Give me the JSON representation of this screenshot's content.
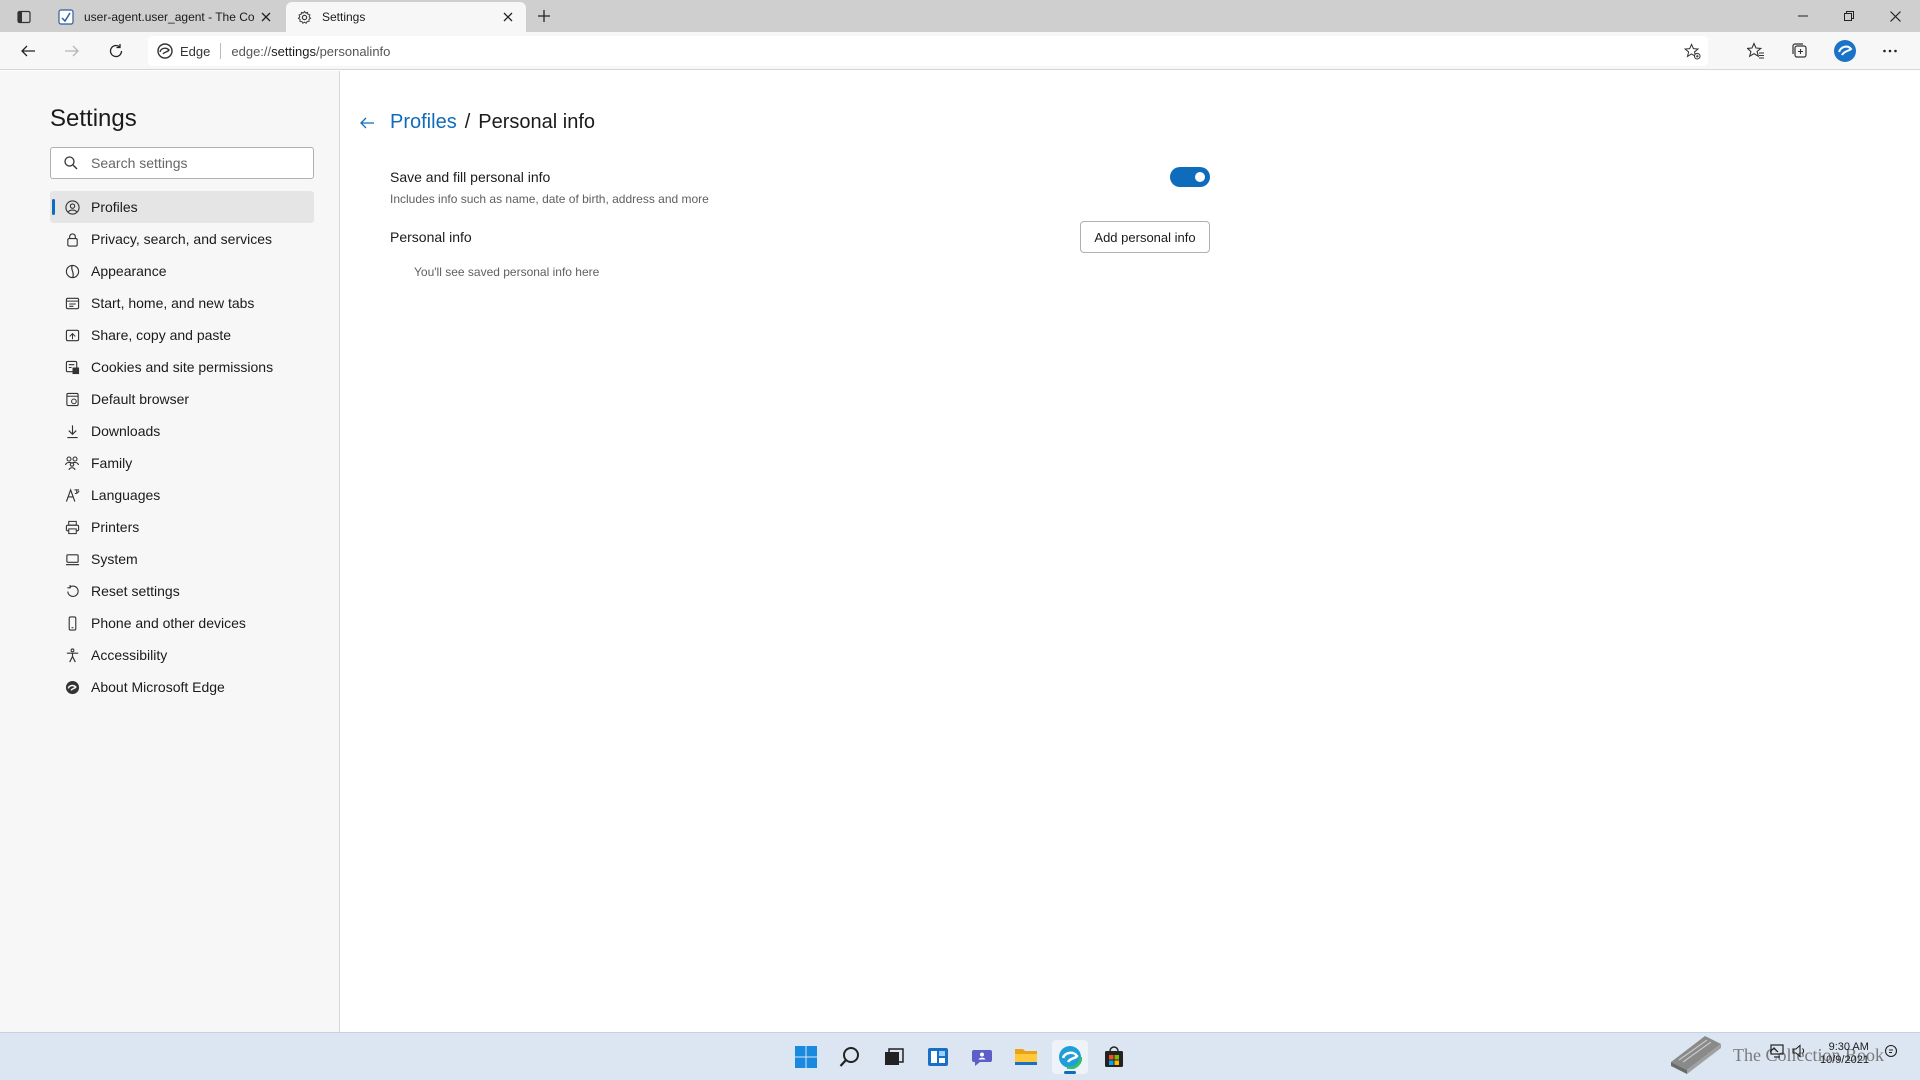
{
  "browser": {
    "tabs": [
      {
        "title": "user-agent.user_agent - The Coll",
        "icon": "page-icon",
        "active": false
      },
      {
        "title": "Settings",
        "icon": "gear-icon",
        "active": true
      }
    ],
    "site_name": "Edge",
    "url_prefix": "edge://",
    "url_host": "settings",
    "url_path": "/personalinfo"
  },
  "sidebar": {
    "title": "Settings",
    "search_placeholder": "Search settings",
    "items": [
      {
        "label": "Profiles",
        "icon": "profile-icon",
        "active": true
      },
      {
        "label": "Privacy, search, and services",
        "icon": "lock-icon"
      },
      {
        "label": "Appearance",
        "icon": "appearance-icon"
      },
      {
        "label": "Start, home, and new tabs",
        "icon": "home-tabs-icon"
      },
      {
        "label": "Share, copy and paste",
        "icon": "share-icon"
      },
      {
        "label": "Cookies and site permissions",
        "icon": "cookies-icon"
      },
      {
        "label": "Default browser",
        "icon": "browser-icon"
      },
      {
        "label": "Downloads",
        "icon": "download-icon"
      },
      {
        "label": "Family",
        "icon": "family-icon"
      },
      {
        "label": "Languages",
        "icon": "languages-icon"
      },
      {
        "label": "Printers",
        "icon": "printer-icon"
      },
      {
        "label": "System",
        "icon": "system-icon"
      },
      {
        "label": "Reset settings",
        "icon": "reset-icon"
      },
      {
        "label": "Phone and other devices",
        "icon": "phone-icon"
      },
      {
        "label": "Accessibility",
        "icon": "accessibility-icon"
      },
      {
        "label": "About Microsoft Edge",
        "icon": "edge-icon"
      }
    ]
  },
  "main": {
    "breadcrumb_link": "Profiles",
    "breadcrumb_sep": "/",
    "breadcrumb_current": "Personal info",
    "save_fill_label": "Save and fill personal info",
    "save_fill_desc": "Includes info such as name, date of birth, address and more",
    "save_fill_enabled": true,
    "personal_info_label": "Personal info",
    "add_button": "Add personal info",
    "empty_note": "You'll see saved personal info here"
  },
  "taskbar": {
    "time": "9:30 AM",
    "date": "10/9/2021",
    "watermark": "The Collection Book"
  },
  "colors": {
    "accent": "#0f6cbd",
    "sidebar_bg": "#f7f7f7",
    "taskbar_bg": "#dce6f2"
  }
}
